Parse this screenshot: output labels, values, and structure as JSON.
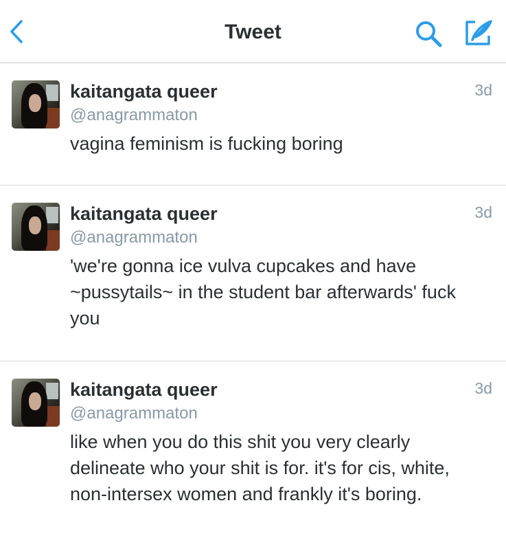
{
  "nav": {
    "title": "Tweet",
    "back_icon": "chevron-left-icon",
    "search_icon": "search-icon",
    "compose_icon": "compose-tweet-icon",
    "accent_color": "#2b9ce8"
  },
  "tweets": [
    {
      "name": "kaitangata queer",
      "handle": "@anagrammaton",
      "time": "3d",
      "text": "vagina feminism is fucking boring"
    },
    {
      "name": "kaitangata queer",
      "handle": "@anagrammaton",
      "time": "3d",
      "text": "'we're gonna ice vulva cupcakes and have ~pussytails~ in the student bar afterwards' fuck you"
    },
    {
      "name": "kaitangata queer",
      "handle": "@anagrammaton",
      "time": "3d",
      "text": "like when you do this shit you very clearly delineate who your shit is for. it's for cis, white, non-intersex women and frankly it's boring."
    }
  ]
}
